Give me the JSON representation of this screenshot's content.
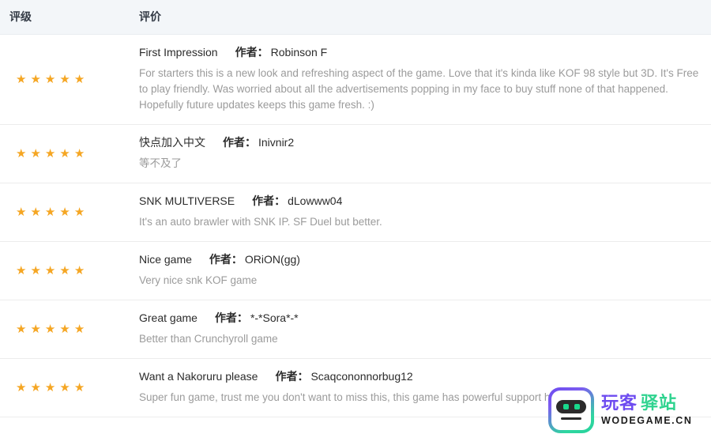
{
  "table": {
    "columns": {
      "rating": "评级",
      "review": "评价"
    },
    "author_label": "作者：",
    "star_glyph": "★",
    "colors": {
      "star": "#f5a623",
      "header_bg": "#f3f6f9",
      "divider": "#ececec",
      "title_text": "#2b2b2b",
      "body_text": "#9b9b9b"
    }
  },
  "reviews": [
    {
      "stars": 5,
      "title": "First Impression",
      "author": "Robinson F",
      "body": "For starters this is a new look and refreshing aspect of the game. Love that it's kinda like KOF 98 style but 3D. It's Free to play friendly. Was worried about all the advertisements popping in my face to buy stuff none of that happened. Hopefully future updates keeps this game fresh. :)"
    },
    {
      "stars": 5,
      "title": "快点加入中文",
      "author": "Inivnir2",
      "body": "等不及了"
    },
    {
      "stars": 5,
      "title": "SNK MULTIVERSE",
      "author": "dLowww04",
      "body": "It's an auto brawler with SNK IP. SF Duel but better."
    },
    {
      "stars": 5,
      "title": "Nice game",
      "author": "ORiON(gg)",
      "body": "Very nice snk KOF game"
    },
    {
      "stars": 5,
      "title": "Great game",
      "author": "*-*Sora*-*",
      "body": "Better than Crunchyroll game"
    },
    {
      "stars": 5,
      "title": "Want a Nakoruru please",
      "author": "Scaqcononnorbug12",
      "body": "Super fun game, trust me you don't want to miss this, this game has powerful support heroe"
    }
  ],
  "watermark": {
    "brand_cn_primary": "玩客",
    "brand_cn_secondary": "驿站",
    "brand_en": "WODEGAME.CN",
    "logo_color_start": "#6d4bf0",
    "logo_color_end": "#2fd6a0"
  }
}
